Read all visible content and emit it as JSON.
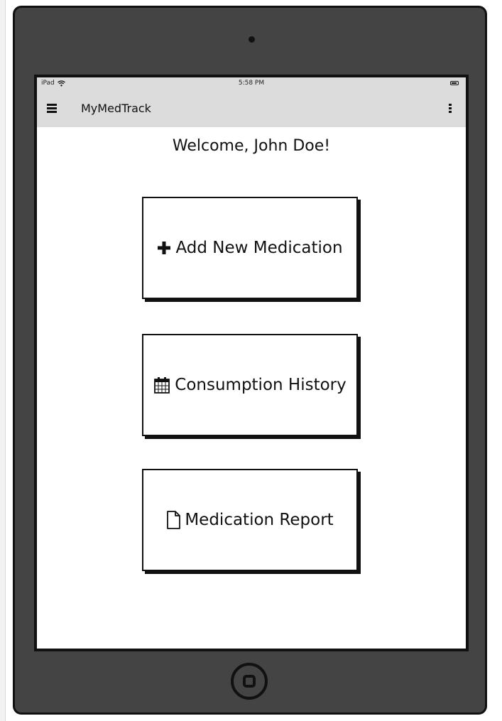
{
  "status_bar": {
    "device_label": "iPad",
    "time": "5:58 PM",
    "icons": [
      "wifi-icon",
      "battery-icon"
    ]
  },
  "toolbar": {
    "menu_icon": "hamburger-menu-icon",
    "title": "MyMedTrack",
    "overflow_icon": "more-vertical-icon"
  },
  "welcome": "Welcome, John Doe!",
  "actions": [
    {
      "label": "Add New Medication",
      "icon": "plus-icon"
    },
    {
      "label": "Consumption History",
      "icon": "calendar-icon"
    },
    {
      "label": "Medication Report",
      "icon": "file-icon"
    }
  ],
  "colors": {
    "device_frame": "#444444",
    "toolbar_bg": "#dcdcdc",
    "ink": "#111111"
  }
}
